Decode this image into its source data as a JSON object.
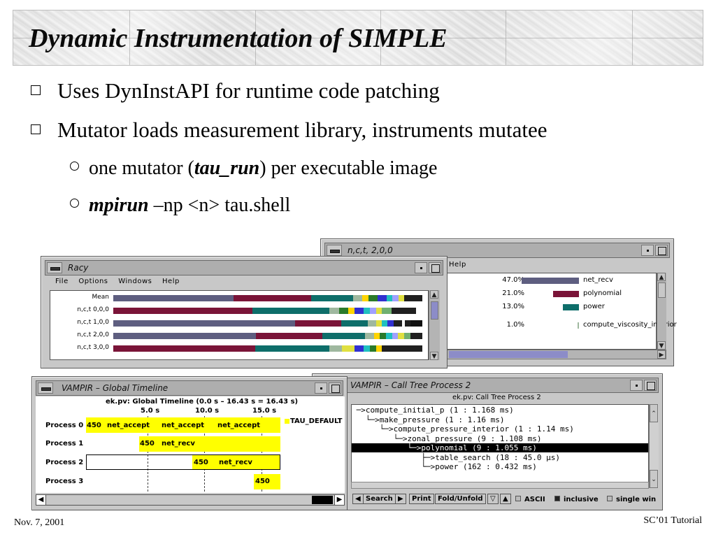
{
  "slide": {
    "title": "Dynamic Instrumentation of SIMPLE",
    "bullets": [
      {
        "text": "Uses DynInstAPI for runtime code patching"
      },
      {
        "text": "Mutator loads measurement library, instruments mutatee"
      }
    ],
    "sub_bullets": [
      {
        "pre": "one mutator (",
        "bold": "tau_run",
        "post": ") per executable image"
      },
      {
        "bold": "mpirun",
        "post": " –np <n> tau.shell"
      }
    ],
    "footer_left": "Nov. 7, 2001",
    "footer_right": "SC’01 Tutorial"
  },
  "racy": {
    "title": "Racy",
    "menu": [
      "File",
      "Options",
      "Windows",
      "Help"
    ],
    "rows": [
      {
        "label": "Mean",
        "segments": [
          [
            "#5e5e80",
            0.4
          ],
          [
            "#7a1438",
            0.26
          ],
          [
            "#0e6e6a",
            0.14
          ],
          [
            "#9fb89f",
            0.03
          ],
          [
            "#ffd400",
            0.02
          ],
          [
            "#2a7a2a",
            0.03
          ],
          [
            "#3030d0",
            0.03
          ],
          [
            "#20c0c0",
            0.02
          ],
          [
            "#a0a0ff",
            0.02
          ],
          [
            "#e0e040",
            0.02
          ],
          [
            "#202020",
            0.06
          ]
        ]
      },
      {
        "label": "n,c,t   0,0,0",
        "segments": [
          [
            "#7a1438",
            0.45
          ],
          [
            "#0e6e6a",
            0.25
          ],
          [
            "#9fb89f",
            0.03
          ],
          [
            "#2a7a2a",
            0.03
          ],
          [
            "#ffd400",
            0.02
          ],
          [
            "#3030d0",
            0.03
          ],
          [
            "#20c0c0",
            0.02
          ],
          [
            "#a0a0ff",
            0.02
          ],
          [
            "#e0e040",
            0.02
          ],
          [
            "#70b070",
            0.03
          ],
          [
            "#202020",
            0.08
          ]
        ]
      },
      {
        "label": "n,c,t   1,0,0",
        "segments": [
          [
            "#5e5e80",
            0.63
          ],
          [
            "#7a1438",
            0.16
          ],
          [
            "#0e6e6a",
            0.09
          ],
          [
            "#9fb89f",
            0.03
          ],
          [
            "#e0e040",
            0.02
          ],
          [
            "#20c0c0",
            0.02
          ],
          [
            "#3030d0",
            0.02
          ],
          [
            "#202020",
            0.03
          ],
          [
            "#ffffff",
            0.01
          ],
          [
            "#202020",
            0.02
          ],
          [
            "#111111",
            0.04
          ]
        ]
      },
      {
        "label": "n,c,t   2,0,0",
        "segments": [
          [
            "#5e5e80",
            0.47
          ],
          [
            "#7a1438",
            0.22
          ],
          [
            "#0e6e6a",
            0.14
          ],
          [
            "#9fb89f",
            0.03
          ],
          [
            "#ffd400",
            0.02
          ],
          [
            "#2a7a2a",
            0.02
          ],
          [
            "#20c0c0",
            0.02
          ],
          [
            "#a0a0ff",
            0.02
          ],
          [
            "#e0e040",
            0.02
          ],
          [
            "#70b070",
            0.02
          ],
          [
            "#202020",
            0.04
          ]
        ]
      },
      {
        "label": "n,c,t   3,0,0",
        "segments": [
          [
            "#7a1438",
            0.46
          ],
          [
            "#0e6e6a",
            0.24
          ],
          [
            "#9fb89f",
            0.04
          ],
          [
            "#e0e040",
            0.04
          ],
          [
            "#3030d0",
            0.03
          ],
          [
            "#20c0c0",
            0.02
          ],
          [
            "#2a7a2a",
            0.02
          ],
          [
            "#ffd400",
            0.02
          ],
          [
            "#202020",
            0.13
          ]
        ]
      }
    ]
  },
  "profile": {
    "title": "n,c,t, 2,0,0",
    "menu": "Help",
    "rows": [
      {
        "pct": "47.0%",
        "name": "net_recv",
        "color": "#5e5e80",
        "fraction": 1.0
      },
      {
        "pct": "21.0%",
        "name": "polynomial",
        "color": "#7a1438",
        "fraction": 0.45
      },
      {
        "pct": "13.0%",
        "name": "power",
        "color": "#0e6e6a",
        "fraction": 0.28
      },
      {
        "pct": "1.0%",
        "name": "compute_viscosity_interior",
        "color": "#9fb89f",
        "fraction": 0.02
      }
    ]
  },
  "vampir": {
    "title": "VAMPIR – Global Timeline",
    "header": "ek.pv: Global Timeline (0.0 s – 16.43 s = 16.43 s)",
    "ticks": [
      "5.0 s",
      "10.0 s",
      "15.0 s"
    ],
    "legend": "TAU_DEFAULT",
    "processes": [
      {
        "label": "Process 0",
        "labels": [
          "450",
          "net_accept",
          "net_accept",
          "net_accept"
        ]
      },
      {
        "label": "Process 1",
        "labels": [
          "450",
          "net_recv"
        ]
      },
      {
        "label": "Process 2",
        "labels": [
          "450",
          "net_recv"
        ]
      },
      {
        "label": "Process 3",
        "labels": [
          "450"
        ]
      }
    ]
  },
  "calltree": {
    "title": "VAMPIR – Call Tree Process 2",
    "header": "ek.pv: Call Tree Process 2",
    "lines": [
      " ─>compute_initial_p (1 : 1.168 ms)",
      "   └─>make_pressure (1 : 1.16 ms)",
      "      └─>compute_pressure_interior (1 : 1.14 ms)",
      "         └─>zonal_pressure (9 : 1.108 ms)",
      "            └─>polynomial (9 : 1.055 ms)",
      "               ├─>table_search (18 : 45.0 μs)",
      "               └─>power (162 : 0.432 ms)"
    ],
    "highlight_index": 4,
    "buttons": [
      "Search",
      "Print",
      "Fold/Unfold"
    ],
    "checks": [
      {
        "label": "ASCII",
        "on": false
      },
      {
        "label": "inclusive",
        "on": true
      },
      {
        "label": "single win",
        "on": false
      }
    ]
  }
}
